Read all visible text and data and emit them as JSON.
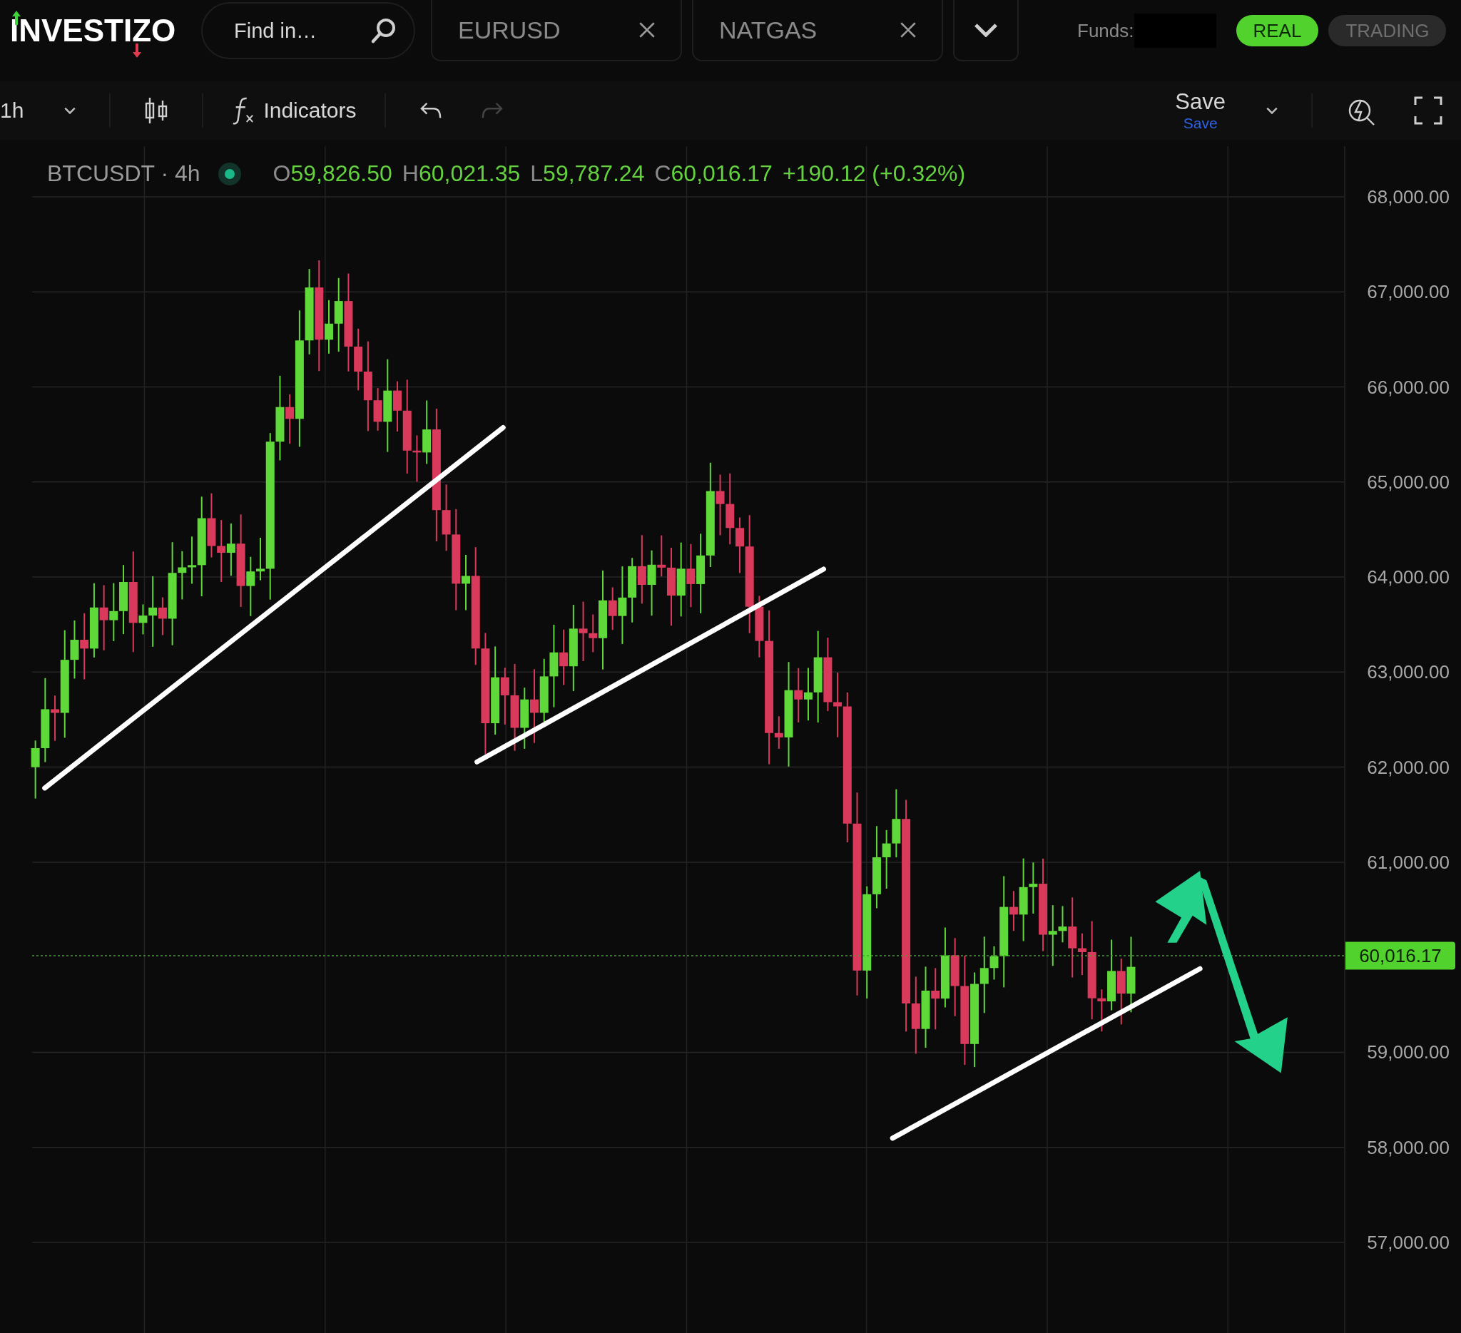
{
  "header": {
    "logo": "INVESTIZO",
    "search": {
      "placeholder": "Find in…"
    },
    "tabs": [
      {
        "label": "EURUSD"
      },
      {
        "label": "NATGAS"
      }
    ],
    "funds_label": "Funds:",
    "account_modes": [
      {
        "label": "REAL",
        "selected": true
      },
      {
        "label": "TRADING",
        "selected": false
      }
    ]
  },
  "toolbar": {
    "interval": "1h",
    "indicators": "Indicators",
    "undo": {
      "disabled": false
    },
    "redo": {
      "disabled": true
    },
    "save": {
      "label": "Save",
      "sublabel": "Save"
    }
  },
  "chart": {
    "symbol": "BTCUSDT · 4h",
    "legend": [
      {
        "prefix": "O",
        "value": "59,826.50"
      },
      {
        "prefix": "H",
        "value": "60,021.35"
      },
      {
        "prefix": "L",
        "value": "59,787.24"
      },
      {
        "prefix": "C",
        "value": "60,016.17"
      }
    ],
    "change": "+190.12 (+0.32%)",
    "price_axis": [
      "68,000.00",
      "67,000.00",
      "66,000.00",
      "65,000.00",
      "64,000.00",
      "63,000.00",
      "62,000.00",
      "61,000.00",
      "59,000.00",
      "58,000.00",
      "57,000.00"
    ],
    "last_price": "60,016.17"
  }
}
